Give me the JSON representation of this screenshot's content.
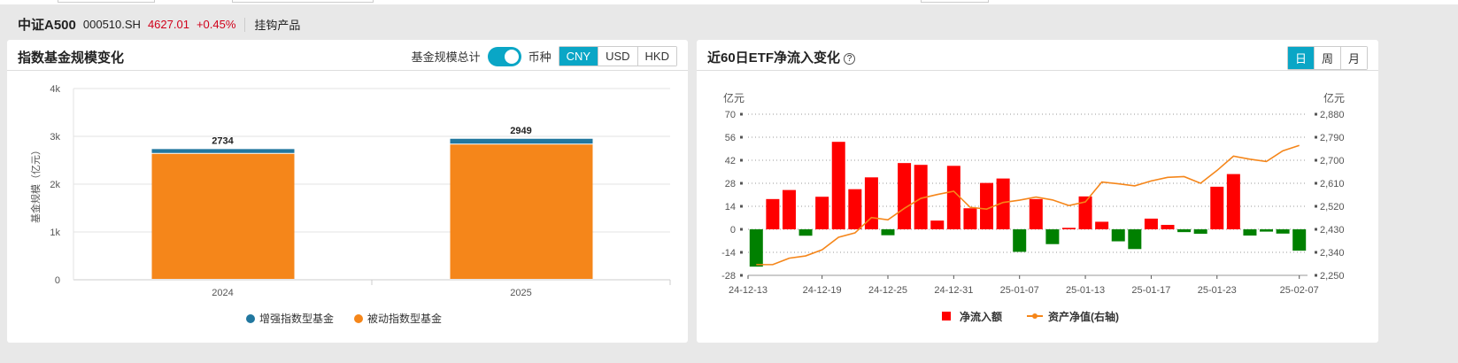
{
  "header": {
    "name": "中证A500",
    "code": "000510.SH",
    "price": "4627.01",
    "change": "+0.45%",
    "link": "挂钩产品"
  },
  "left_panel": {
    "title": "指数基金规模变化",
    "toggle_label": "基金规模总计",
    "toggle_on": true,
    "currency_label": "币种",
    "currencies": [
      "CNY",
      "USD",
      "HKD"
    ],
    "selected_currency": "CNY"
  },
  "right_panel": {
    "title": "近60日ETF净流入变化",
    "help": "?",
    "periods": [
      "日",
      "周",
      "月"
    ],
    "selected_period": "日"
  },
  "colors": {
    "accent": "#0aa6c6",
    "enhanced": "#21779f",
    "passive": "#f5861a",
    "inflow_pos": "#ff0000",
    "inflow_neg": "#008000",
    "nav": "#f5861a"
  },
  "chart_data": [
    {
      "type": "bar",
      "stacked": true,
      "title": "指数基金规模变化",
      "ylabel": "基金规模（亿元）",
      "ylim": [
        0,
        4000
      ],
      "yticks": [
        "0",
        "1k",
        "2k",
        "3k",
        "4k"
      ],
      "yticks_values": [
        0,
        1000,
        2000,
        3000,
        4000
      ],
      "categories": [
        "2024",
        "2025"
      ],
      "series": [
        {
          "name": "被动指数型基金",
          "values": [
            2634,
            2829
          ]
        },
        {
          "name": "增强指数型基金",
          "values": [
            100,
            120
          ]
        }
      ],
      "totals": [
        "2734",
        "2949"
      ],
      "legend": [
        "增强指数型基金",
        "被动指数型基金"
      ],
      "legend_position": "bottom"
    },
    {
      "type": "bar+line",
      "title": "近60日ETF净流入变化",
      "y_unit": "亿元",
      "y2_unit": "亿元",
      "ylim": [
        -28,
        70
      ],
      "yticks": [
        "-28",
        "-14",
        "0",
        "14",
        "28",
        "42",
        "56",
        "70"
      ],
      "y2lim": [
        2250,
        2880
      ],
      "y2ticks": [
        "2,250",
        "2,340",
        "2,430",
        "2,520",
        "2,610",
        "2,700",
        "2,790",
        "2,880"
      ],
      "x_labels": [
        {
          "index": 0,
          "label": "24-12-13"
        },
        {
          "index": 4,
          "label": "24-12-19"
        },
        {
          "index": 8,
          "label": "24-12-25"
        },
        {
          "index": 12,
          "label": "24-12-31"
        },
        {
          "index": 16,
          "label": "25-01-07"
        },
        {
          "index": 20,
          "label": "25-01-13"
        },
        {
          "index": 24,
          "label": "25-01-17"
        },
        {
          "index": 28,
          "label": "25-01-23"
        },
        {
          "index": 33,
          "label": "25-02-07"
        }
      ],
      "series": [
        {
          "name": "净流入额",
          "type": "bar",
          "values": [
            -22.7,
            18.4,
            23.9,
            -3.9,
            19.8,
            53.2,
            24.4,
            31.6,
            -3.6,
            40.3,
            39.2,
            5.3,
            38.6,
            12.8,
            28.2,
            30.9,
            -13.7,
            18.4,
            -9,
            0.9,
            20,
            4.6,
            -7.3,
            -12,
            6.5,
            2.7,
            -1.7,
            -2.7,
            25.9,
            33.6,
            -3.8,
            -1.4,
            -2.6,
            -13
          ]
        },
        {
          "name": "资产净值(右轴)",
          "type": "line",
          "values": [
            2292,
            2292,
            2317,
            2326,
            2350,
            2399,
            2416,
            2476,
            2467,
            2512,
            2551,
            2566,
            2579,
            2516,
            2509,
            2535,
            2544,
            2556,
            2545,
            2523,
            2537,
            2615,
            2608,
            2600,
            2619,
            2633,
            2636,
            2610,
            2660,
            2716,
            2704,
            2695,
            2737,
            2758
          ]
        }
      ],
      "legend": [
        "净流入额",
        "资产净值(右轴)"
      ],
      "legend_position": "bottom",
      "grid": true
    }
  ]
}
